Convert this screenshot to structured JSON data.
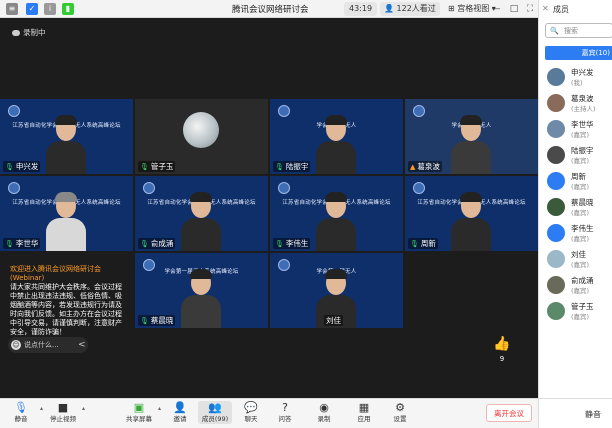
{
  "titlebar": {
    "title": "腾讯会议网络研讨会",
    "timer": "43:19",
    "viewers": "122人看过",
    "grid_view": "宫格视图",
    "win_buttons": [
      "□",
      "—",
      "✕"
    ]
  },
  "recording": "录制中",
  "tiles": [
    {
      "name": "申兴发",
      "bg": "江苏省自动化学会第一届无人系统高峰论坛",
      "mic": true
    },
    {
      "name": "管子玉",
      "bg": "",
      "mic": true,
      "dark": true
    },
    {
      "name": "陆振宇",
      "bg": "学会第一届无人",
      "mic": true
    },
    {
      "name": "葛泉波",
      "bg": "学会第一届无人",
      "mic": true
    },
    {
      "name": "李世华",
      "bg": "江苏省自动化学会第一届无人系统高峰论坛",
      "mic": true
    },
    {
      "name": "俞成涌",
      "bg": "江苏省自动化学会第一届无人系统高峰论坛",
      "mic": true
    },
    {
      "name": "李伟生",
      "bg": "江苏省自动化学会第一届无人系统高峰论坛",
      "mic": true
    },
    {
      "name": "周新",
      "bg": "江苏省自动化学会第一届无人系统高峰论坛",
      "mic": true
    },
    {
      "name": "蔡晨晓",
      "bg": "学会第一届无人系统高峰论坛",
      "mic": true
    },
    {
      "name": "刘佳",
      "bg": "学会第一届无人",
      "mic": false
    }
  ],
  "chat": {
    "head": "欢迎进入腾讯会议网络研讨会(Webinar)",
    "body": "请大家共同维护大会秩序。会议过程中禁止出现违法违规、低俗色情、吸烟酗酒等内容，若发现违规行为请及时向我们反馈。如主办方在会议过程中引导交易，请谨慎判断，注意财产安全，谨防诈骗！",
    "input_placeholder": "说点什么...",
    "arrow": "<"
  },
  "like": {
    "icon": "thumbs-up-icon",
    "count": "9"
  },
  "toolbar": {
    "mute": "静音",
    "stop_video": "停止视频",
    "share": "共享屏幕",
    "invite": "邀请",
    "members": "成员(99)",
    "chat": "聊天",
    "qa": "问答",
    "record": "录制",
    "apps": "应用",
    "settings": "设置",
    "leave": "离开会议"
  },
  "panel": {
    "title": "成员",
    "search_placeholder": "搜索",
    "tab": "嘉宾(10)",
    "members": [
      {
        "name": "申兴发",
        "role": "(我)",
        "color": "#5a7a9a"
      },
      {
        "name": "葛泉波",
        "role": "(主持人)",
        "color": "#8a6a5a"
      },
      {
        "name": "李世华",
        "role": "(嘉宾)",
        "color": "#6f8aa8"
      },
      {
        "name": "陆振宇",
        "role": "(嘉宾)",
        "color": "#4a4a4a"
      },
      {
        "name": "周新",
        "role": "(嘉宾)",
        "color": "#2c7df4"
      },
      {
        "name": "蔡晨晓",
        "role": "(嘉宾)",
        "color": "#3a5a3a"
      },
      {
        "name": "李伟生",
        "role": "(嘉宾)",
        "color": "#2c7df4"
      },
      {
        "name": "刘佳",
        "role": "(嘉宾)",
        "color": "#9ab8c8"
      },
      {
        "name": "俞成涌",
        "role": "(嘉宾)",
        "color": "#6a6a5a"
      },
      {
        "name": "管子玉",
        "role": "(嘉宾)",
        "color": "#5a8a6a"
      }
    ],
    "mute_all": "静音"
  }
}
